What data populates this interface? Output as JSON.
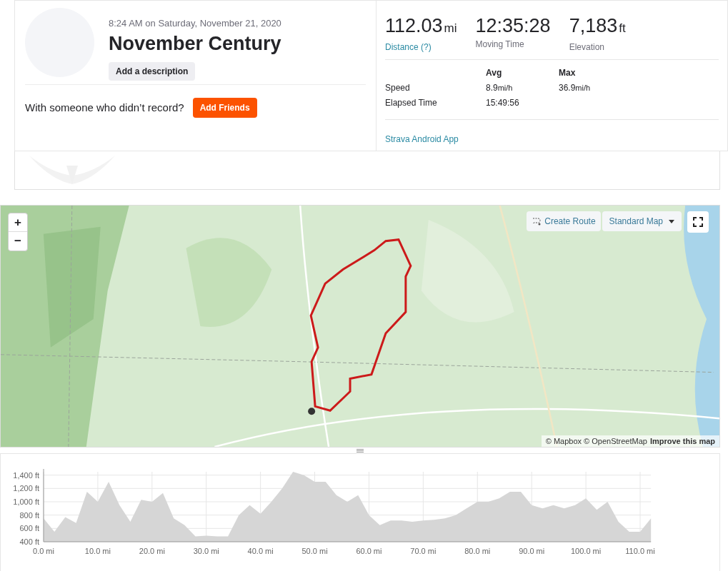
{
  "activity": {
    "time": "8:24 AM on Saturday, November 21, 2020",
    "title": "November Century",
    "description_button": "Add a description"
  },
  "friends": {
    "prompt": "With someone who didn’t record?",
    "button": "Add Friends"
  },
  "stats": [
    {
      "value": "112.03",
      "unit": "mi",
      "label": "Distance (?)",
      "kind": "link"
    },
    {
      "value": "12:35:28",
      "label": "Moving Time",
      "kind": "plain"
    },
    {
      "value": "7,183",
      "unit": "ft",
      "label": "Elevation",
      "kind": "plain"
    }
  ],
  "details": {
    "columns": [
      "Avg",
      "Max"
    ],
    "rows": [
      {
        "label": "Speed",
        "cells": [
          {
            "value": "8.9",
            "unit": "mi/h"
          },
          {
            "value": "36.9",
            "unit": "mi/h"
          }
        ]
      },
      {
        "label": "Elapsed Time",
        "cells": [
          {
            "value": "15:49:56"
          }
        ]
      }
    ]
  },
  "device": "Strava Android App",
  "map": {
    "zoom_in": "+",
    "zoom_out": "−",
    "create_route": "Create Route",
    "map_style": "Standard Map",
    "attribution": "© Mapbox © OpenStreetMap",
    "improve_link": "Improve this map"
  },
  "elevation": {
    "chart_data": {
      "type": "area",
      "xlim": [
        0,
        112
      ],
      "ylim": [
        400,
        1450
      ],
      "xticks": [
        {
          "value": 0,
          "label": "0.0 mi"
        },
        {
          "value": 10,
          "label": "10.0 mi"
        },
        {
          "value": 20,
          "label": "20.0 mi"
        },
        {
          "value": 30,
          "label": "30.0 mi"
        },
        {
          "value": 40,
          "label": "40.0 mi"
        },
        {
          "value": 50,
          "label": "50.0 mi"
        },
        {
          "value": 60,
          "label": "60.0 mi"
        },
        {
          "value": 70,
          "label": "70.0 mi"
        },
        {
          "value": 80,
          "label": "80.0 mi"
        },
        {
          "value": 90,
          "label": "90.0 mi"
        },
        {
          "value": 100,
          "label": "100.0 mi"
        },
        {
          "value": 110,
          "label": "110.0 mi"
        }
      ],
      "yticks": [
        {
          "value": 400,
          "label": "400 ft"
        },
        {
          "value": 600,
          "label": "600 ft"
        },
        {
          "value": 800,
          "label": "800 ft"
        },
        {
          "value": 1000,
          "label": "1,000 ft"
        },
        {
          "value": 1200,
          "label": "1,200 ft"
        },
        {
          "value": 1400,
          "label": "1,400 ft"
        }
      ],
      "x": [
        0,
        2,
        4,
        6,
        8,
        10,
        12,
        14,
        16,
        18,
        20,
        22,
        24,
        26,
        28,
        30,
        32,
        34,
        36,
        38,
        40,
        42,
        44,
        46,
        48,
        50,
        52,
        54,
        56,
        58,
        60,
        62,
        64,
        66,
        68,
        70,
        72,
        74,
        76,
        78,
        80,
        82,
        84,
        86,
        88,
        90,
        92,
        94,
        96,
        98,
        100,
        102,
        104,
        106,
        108,
        110,
        112
      ],
      "grid": true,
      "series": [
        {
          "color": "#d6d6d6",
          "values": [
            750,
            550,
            770,
            680,
            1150,
            1000,
            1300,
            950,
            700,
            1030,
            1000,
            1130,
            750,
            650,
            480,
            490,
            480,
            480,
            800,
            950,
            820,
            1000,
            1200,
            1450,
            1400,
            1300,
            1300,
            1100,
            1000,
            1100,
            800,
            650,
            720,
            720,
            700,
            720,
            730,
            750,
            800,
            900,
            1000,
            1000,
            1050,
            1150,
            1150,
            950,
            900,
            950,
            900,
            950,
            1050,
            880,
            1000,
            700,
            550,
            550,
            750
          ]
        }
      ]
    }
  }
}
